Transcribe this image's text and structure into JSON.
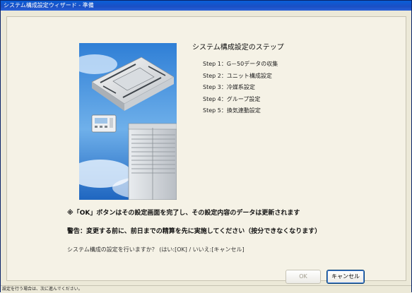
{
  "window": {
    "title": "システム構成設定ウィザード - 準備"
  },
  "wizard": {
    "heading": "システム構成設定のステップ",
    "steps": [
      {
        "label": "Step 1：G－50データの収集"
      },
      {
        "label": "Step 2：ユニット構成設定"
      },
      {
        "label": "Step 3：冷媒系設定"
      },
      {
        "label": "Step 4：グループ設定"
      },
      {
        "label": "Step 5：換気連動設定"
      }
    ],
    "ok_note": "※「OK」ボタンはその設定画面を完了し、その設定内容のデータは更新されます",
    "warning": "警告：変更する前に、前日までの精算を先に実施してください（按分できなくなります）",
    "question": "システム構成の設定を行いますか？ (はい:[OK] / いいえ:[キャンセル]"
  },
  "buttons": {
    "ok_label": "OK",
    "cancel_label": "キャンセル"
  },
  "status_bar": {
    "text": "設定を行う場合は、次に進んでください。"
  }
}
